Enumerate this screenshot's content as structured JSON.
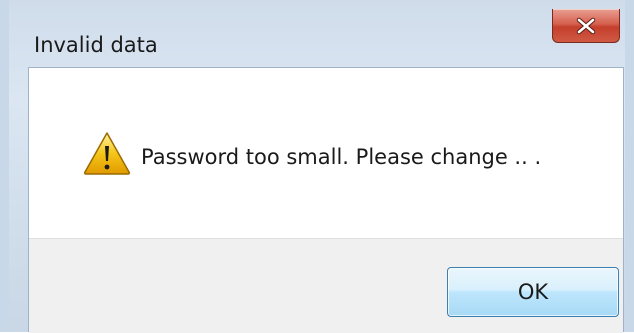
{
  "window": {
    "title": "Invalid data",
    "close_icon": "close-icon"
  },
  "message": {
    "icon": "warning-icon",
    "text": "Password too small. Please change .. ."
  },
  "buttons": {
    "ok_label": "OK"
  },
  "colors": {
    "close_button": "#c43f2c",
    "ok_button_border": "#3c7fb1",
    "footer_background": "#f0f0f0",
    "warning_fill": "#f5c518"
  }
}
